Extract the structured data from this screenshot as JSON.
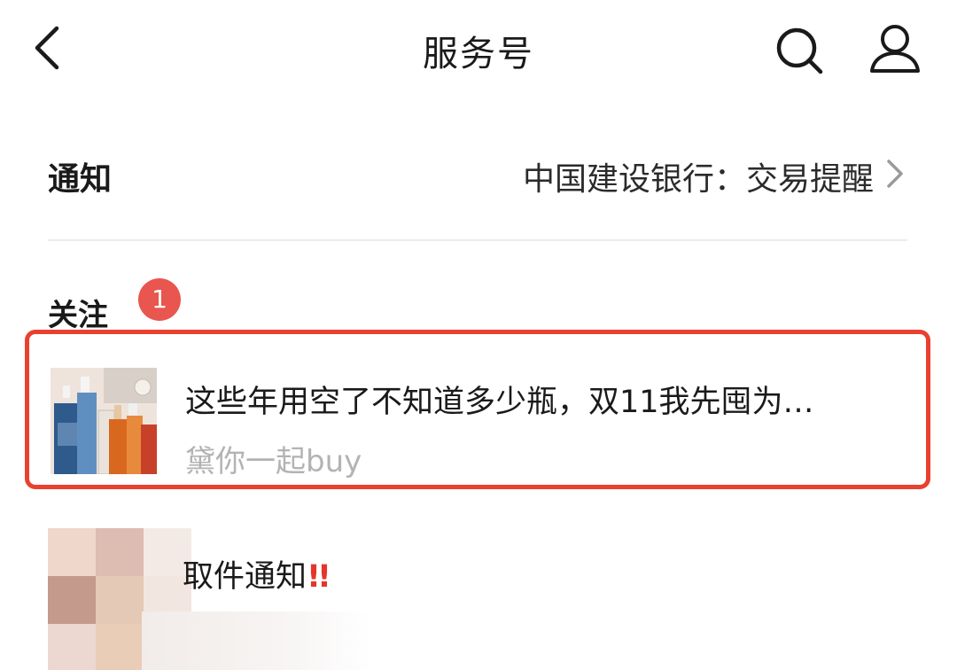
{
  "header": {
    "title": "服务号",
    "icons": {
      "back": "chevron-left-icon",
      "search": "search-icon",
      "profile": "person-icon"
    }
  },
  "notice": {
    "label": "通知",
    "badge_count": "1",
    "summary": "中国建设银行：交易提醒"
  },
  "following": {
    "section_title": "关注",
    "items": [
      {
        "title": "这些年用空了不知道多少瓶，双11我先囤为…",
        "source": "黛你一起buy",
        "highlighted": true,
        "highlight_color": "#e9402f"
      },
      {
        "title": "取件通知",
        "emoji": "!!",
        "emoji_color": "#e5352b"
      }
    ]
  },
  "colors": {
    "badge": "#e8564f",
    "muted_text": "#b3b3b3",
    "divider": "#ececec"
  }
}
